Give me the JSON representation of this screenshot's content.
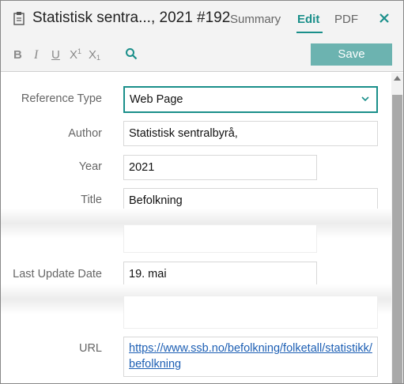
{
  "header": {
    "title": "Statistisk sentra..., 2021 #192",
    "tabs": {
      "summary": "Summary",
      "edit": "Edit",
      "pdf": "PDF"
    },
    "close_icon": "close-icon",
    "doc_icon": "clipboard-icon",
    "accent_color": "#1a8f8a"
  },
  "toolbar": {
    "bold": "B",
    "italic": "I",
    "underline": "U",
    "superscript": {
      "base": "X",
      "mark": "1"
    },
    "subscript": {
      "base": "X",
      "mark": "1"
    },
    "search_icon": "search-icon",
    "save_label": "Save",
    "save_color": "#6cb3b0"
  },
  "form": {
    "reference_type": {
      "label": "Reference Type",
      "value": "Web Page"
    },
    "author": {
      "label": "Author",
      "value": "Statistisk sentralbyrå,"
    },
    "year": {
      "label": "Year",
      "value": "2021"
    },
    "title": {
      "label": "Title",
      "value": "Befolkning"
    },
    "last_update_date": {
      "label": "Last Update Date",
      "value": "19. mai"
    },
    "url": {
      "label": "URL",
      "value": "https://www.ssb.no/befolkning/folketall/statistikk/befolkning"
    }
  }
}
